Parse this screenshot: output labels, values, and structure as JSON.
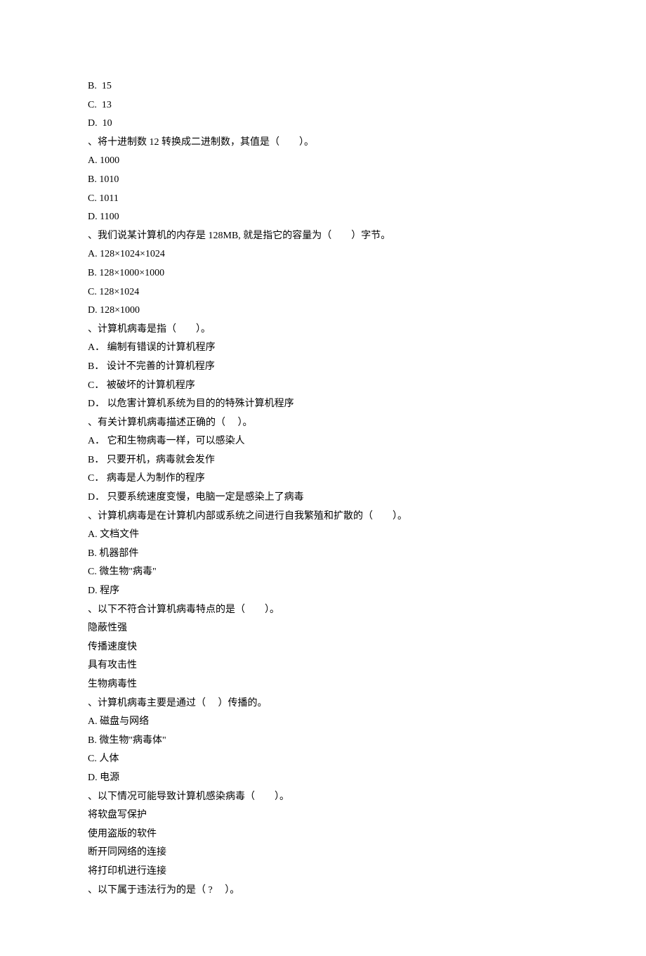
{
  "lines": [
    "B.  15",
    "C.  13",
    "D.  10",
    "、将十进制数 12 转换成二进制数，其值是（　　）。",
    "A. 1000",
    "B. 1010",
    "C. 1011",
    "D. 1100",
    "、我们说某计算机的内存是 128MB, 就是指它的容量为（　　）字节。",
    "A. 128×1024×1024",
    "B. 128×1000×1000",
    "C. 128×1024",
    "D. 128×1000",
    "、计算机病毒是指（　　）。",
    "A． 编制有错误的计算机程序",
    "B． 设计不完善的计算机程序",
    "C． 被破坏的计算机程序",
    "D． 以危害计算机系统为目的的特殊计算机程序",
    "、有关计算机病毒描述正确的（　 ）。",
    "A． 它和生物病毒一样，可以感染人",
    "B． 只要开机，病毒就会发作",
    "C． 病毒是人为制作的程序",
    "D． 只要系统速度变慢，电脑一定是感染上了病毒",
    "、计算机病毒是在计算机内部或系统之间进行自我繁殖和扩散的（　　）。",
    "A. 文档文件",
    "B. 机器部件",
    "C. 微生物\"病毒\"",
    "D. 程序",
    "、以下不符合计算机病毒特点的是（　　）。",
    "隐蔽性强",
    "传播速度快",
    "具有攻击性",
    "生物病毒性",
    "、计算机病毒主要是通过（　 ）传播的。",
    "A. 磁盘与网络",
    "B. 微生物\"病毒体\"",
    "C. 人体",
    "D. 电源",
    "、以下情况可能导致计算机感染病毒（　　）。",
    "将软盘写保护",
    "使用盗版的软件",
    "断开同网络的连接",
    "将打印机进行连接",
    "、以下属于违法行为的是（ ?　 ）。"
  ]
}
